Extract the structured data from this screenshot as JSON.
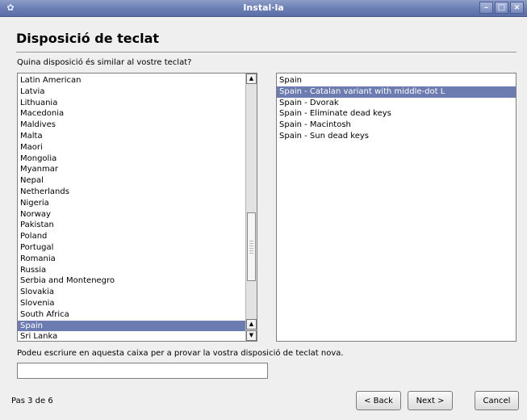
{
  "window": {
    "title": "Instal·la",
    "icon": "install-icon"
  },
  "page": {
    "heading": "Disposició de teclat",
    "question": "Quina disposició és similar al vostre teclat?",
    "hint": "Podeu escriure en aquesta caixa per a provar la vostra disposició de teclat nova.",
    "step": "Pas 3 de 6"
  },
  "layouts": [
    "Latin American",
    "Latvia",
    "Lithuania",
    "Macedonia",
    "Maldives",
    "Malta",
    "Maori",
    "Mongolia",
    "Myanmar",
    "Nepal",
    "Netherlands",
    "Nigeria",
    "Norway",
    "Pakistan",
    "Poland",
    "Portugal",
    "Romania",
    "Russia",
    "Serbia and Montenegro",
    "Slovakia",
    "Slovenia",
    "South Africa",
    "Spain",
    "Sri Lanka"
  ],
  "selected_layout": "Spain",
  "variants": [
    "Spain",
    "Spain - Catalan variant with middle-dot L",
    "Spain - Dvorak",
    "Spain - Eliminate dead keys",
    "Spain - Macintosh",
    "Spain - Sun dead keys"
  ],
  "selected_variant": "Spain - Catalan variant with middle-dot L",
  "test_input": {
    "value": "",
    "placeholder": ""
  },
  "buttons": {
    "back": "< Back",
    "next": "Next >",
    "cancel": "Cancel"
  }
}
